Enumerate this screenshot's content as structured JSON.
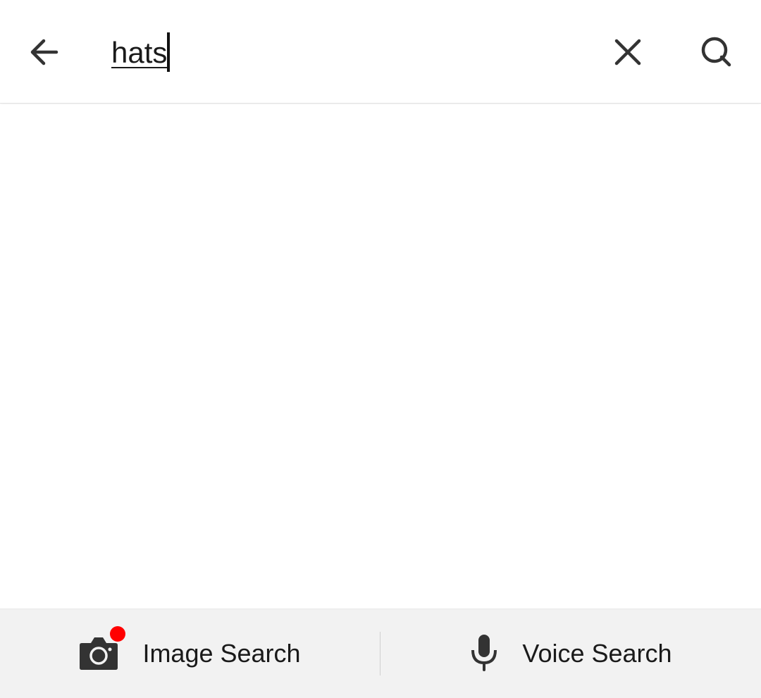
{
  "search": {
    "query": "hats"
  },
  "icons": {
    "back": "arrow-left-icon",
    "clear": "close-icon",
    "search": "search-icon",
    "camera": "camera-icon",
    "microphone": "microphone-icon"
  },
  "bottom_bar": {
    "image_search_label": "Image Search",
    "voice_search_label": "Voice Search"
  },
  "colors": {
    "icon": "#333333",
    "notification_dot": "#ff0000",
    "bottom_bar_bg": "#f2f2f2"
  }
}
